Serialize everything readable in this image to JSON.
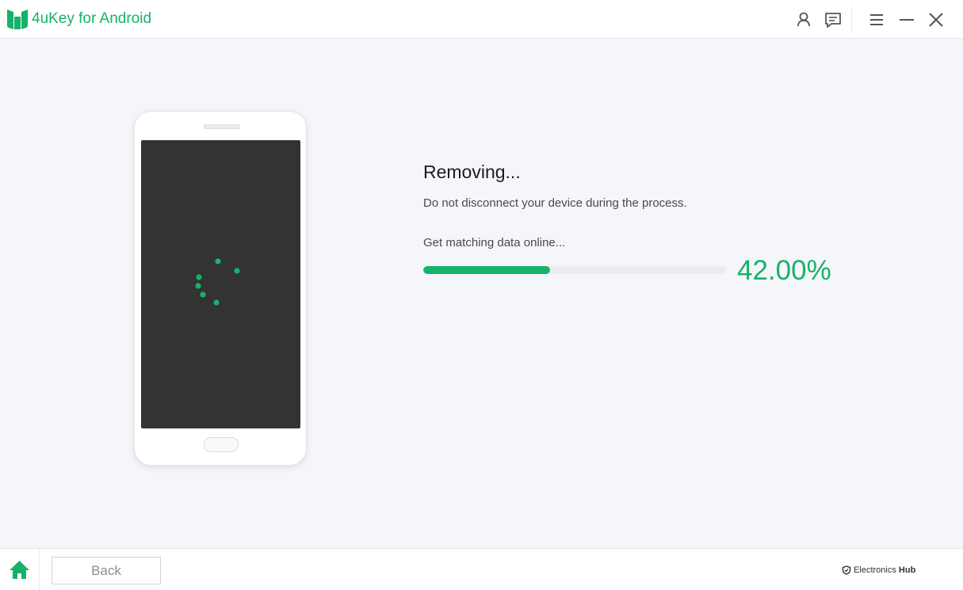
{
  "app": {
    "title": "4uKey for Android",
    "brand_color": "#17b26a"
  },
  "titlebar": {
    "icons": [
      "user-icon",
      "feedback-icon",
      "menu-icon",
      "minimize-icon",
      "close-icon"
    ]
  },
  "status": {
    "title": "Removing...",
    "subtitle": "Do not disconnect your device during the process.",
    "step": "Get matching data online...",
    "progress_fraction": 0.42,
    "progress_label": "42.00%"
  },
  "footer": {
    "back_label": "Back",
    "watermark_prefix": "Electronics",
    "watermark_suffix": "Hub"
  }
}
